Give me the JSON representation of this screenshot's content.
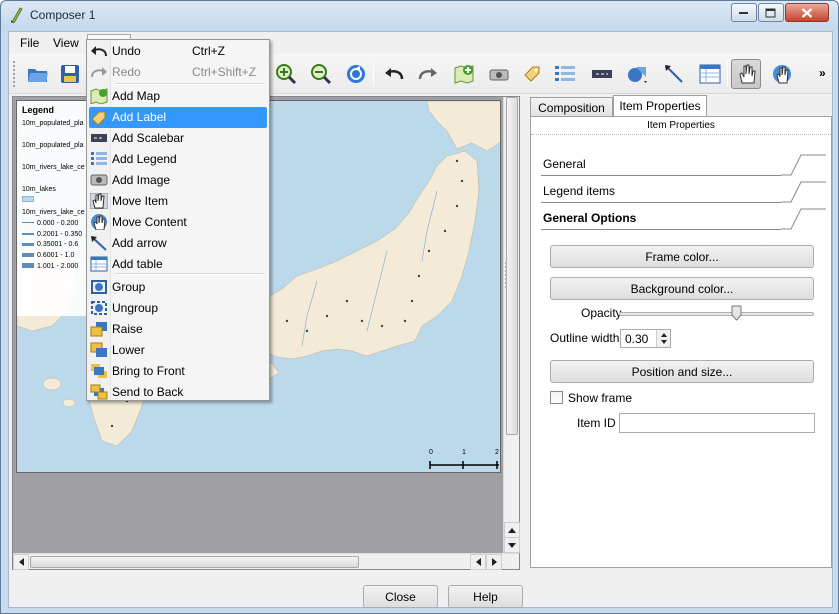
{
  "window": {
    "title": "Composer 1"
  },
  "menubar": {
    "file": "File",
    "view": "View"
  },
  "dropdown": {
    "items": [
      {
        "label": "Undo",
        "shortcut": "Ctrl+Z",
        "icon": "undo-icon",
        "disabled": false
      },
      {
        "label": "Redo",
        "shortcut": "Ctrl+Shift+Z",
        "icon": "redo-icon",
        "disabled": true
      },
      {
        "label": "Add Map",
        "icon": "add-map-icon"
      },
      {
        "label": "Add Label",
        "icon": "add-label-icon",
        "selected": true
      },
      {
        "label": "Add Scalebar",
        "icon": "add-scalebar-icon"
      },
      {
        "label": "Add Legend",
        "icon": "add-legend-icon"
      },
      {
        "label": "Add Image",
        "icon": "add-image-icon"
      },
      {
        "label": "Move Item",
        "icon": "move-item-icon"
      },
      {
        "label": "Move Content",
        "icon": "move-content-icon"
      },
      {
        "label": "Add arrow",
        "icon": "add-arrow-icon"
      },
      {
        "label": "Add table",
        "icon": "add-table-icon"
      },
      {
        "label": "Group",
        "icon": "group-icon"
      },
      {
        "label": "Ungroup",
        "icon": "ungroup-icon"
      },
      {
        "label": "Raise",
        "icon": "raise-icon"
      },
      {
        "label": "Lower",
        "icon": "lower-icon"
      },
      {
        "label": "Bring to Front",
        "icon": "bring-to-front-icon"
      },
      {
        "label": "Send to Back",
        "icon": "send-to-back-icon"
      }
    ]
  },
  "legend": {
    "title": "Legend",
    "entries": [
      "10m_populated_pla",
      "10m_populated_pla",
      "10m_rivers_lake_ce",
      "10m_lakes",
      "10m_rivers_lake_ce",
      "0.000 - 0.200",
      "0.2001 - 0.350",
      "0.35001 - 0.6",
      "0.6001 - 1.0",
      "1.001 - 2.000"
    ]
  },
  "scalebar": {
    "labels": [
      "0",
      "1",
      "2"
    ]
  },
  "properties": {
    "tabs": [
      "Composition",
      "Item Properties"
    ],
    "pane_title": "Item Properties",
    "sections": [
      "General",
      "Legend items",
      "General Options"
    ],
    "frame_color": "Frame color...",
    "background_color": "Background color...",
    "opacity_label": "Opacity",
    "opacity_value": 0.6,
    "outline_label": "Outline width",
    "outline_value": "0.30",
    "position_size": "Position and size...",
    "show_frame": "Show frame",
    "item_id_label": "Item ID",
    "item_id_value": ""
  },
  "footer": {
    "close": "Close",
    "help": "Help"
  },
  "colors": {
    "selection": "#3399ff",
    "water": "#bcd9ec",
    "land": "#f3ead7"
  }
}
